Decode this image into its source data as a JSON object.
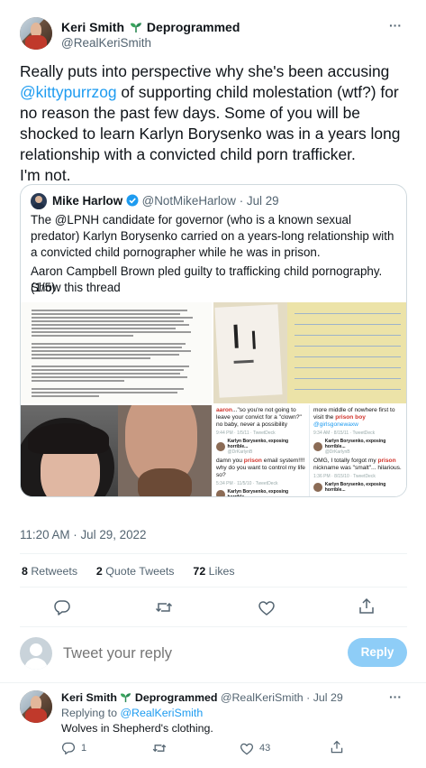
{
  "main_tweet": {
    "author_name": "Keri Smith",
    "author_tag": "Deprogrammed",
    "author_handle": "@RealKeriSmith",
    "more": "···",
    "text_part1": "Really puts into perspective why she's been accusing ",
    "mention": "@kittypurrzog",
    "text_part2": " of supporting child molestation (wtf?) for no reason the past few days. Some of you will be shocked to learn Karlyn Borysenko was in a years long relationship with a convicted child porn trafficker.",
    "text_part3": "I'm not.",
    "timestamp": "11:20 AM · Jul 29, 2022"
  },
  "quoted_tweet": {
    "author_name": "Mike Harlow",
    "author_handle": "@NotMikeHarlow",
    "date": "· Jul 29",
    "text_line1": "The @LPNH candidate for governor (who is a known sexual predator) Karlyn Borysenko carried on a years-long relationship with a convicted child pornographer while he was in prison.",
    "text_line2": "Aaron Campbell Brown pled guilty to trafficking child pornography. (1/5)",
    "show_thread": "Show this thread"
  },
  "screenshots": {
    "s1_top_red": "aaron",
    "s1_top": "...\"so you're not going to leave your convict for a \"clown?\" no baby, never a possibility",
    "s1_meta": "9:44 PM · 1/5/11 · TweetDeck",
    "s1_reply_name": "Karlyn Borysenko, exposing horrible...",
    "s1_reply_handle": "@DrKarlynB",
    "s1_msg_a": "damn you ",
    "s1_msg_red": "prison",
    "s1_msg_b": " email system!!!! why do you want to control my life so?",
    "s1_meta2": "5:34 PM · 11/5/10 · TweetDeck",
    "s1_foot": "Karlyn Borysenko, exposing horrible...",
    "s2_top": "more middle of nowhere first to visit the ",
    "s2_top_red": "prison boy",
    "s2_top_mention": " @girlsgonewaxw",
    "s2_meta": "9:34 AM · 8/15/11 · TweetDeck",
    "s2_reply_name": "Karlyn Borysenko, exposing horrible...",
    "s2_reply_handle": "@DrKarlynB",
    "s2_msg_a": "OMG, I totally forgot my ",
    "s2_msg_red": "prison",
    "s2_msg_b": " nickname was \"smalt\"... hilarious.",
    "s2_meta2": "1:36 PM · 8/15/10 · TweetDeck",
    "s2_foot": "Karlyn Borysenko, exposing horrible..."
  },
  "stats": {
    "retweets_count": "8",
    "retweets_label": "Retweets",
    "quotes_count": "2",
    "quotes_label": "Quote Tweets",
    "likes_count": "72",
    "likes_label": "Likes"
  },
  "reply_box": {
    "placeholder": "Tweet your reply",
    "button": "Reply"
  },
  "reply": {
    "author_name": "Keri Smith",
    "author_tag": "Deprogrammed",
    "author_handle": "@RealKeriSmith",
    "date": "· Jul 29",
    "more": "···",
    "replying_to_label": "Replying to",
    "replying_to_handle": "@RealKeriSmith",
    "text": "Wolves in Shepherd's clothing.",
    "reply_count": "1",
    "like_count": "43"
  },
  "colors": {
    "accent": "#1d9bf0",
    "muted": "#536471",
    "border": "#cfd9de",
    "verified": "#1d9bf0",
    "deprogrammed_sprout": "#2e8b57"
  },
  "icons": [
    "seedling-icon",
    "verified-badge-icon",
    "more-icon",
    "reply-icon",
    "retweet-icon",
    "like-icon",
    "share-icon"
  ]
}
